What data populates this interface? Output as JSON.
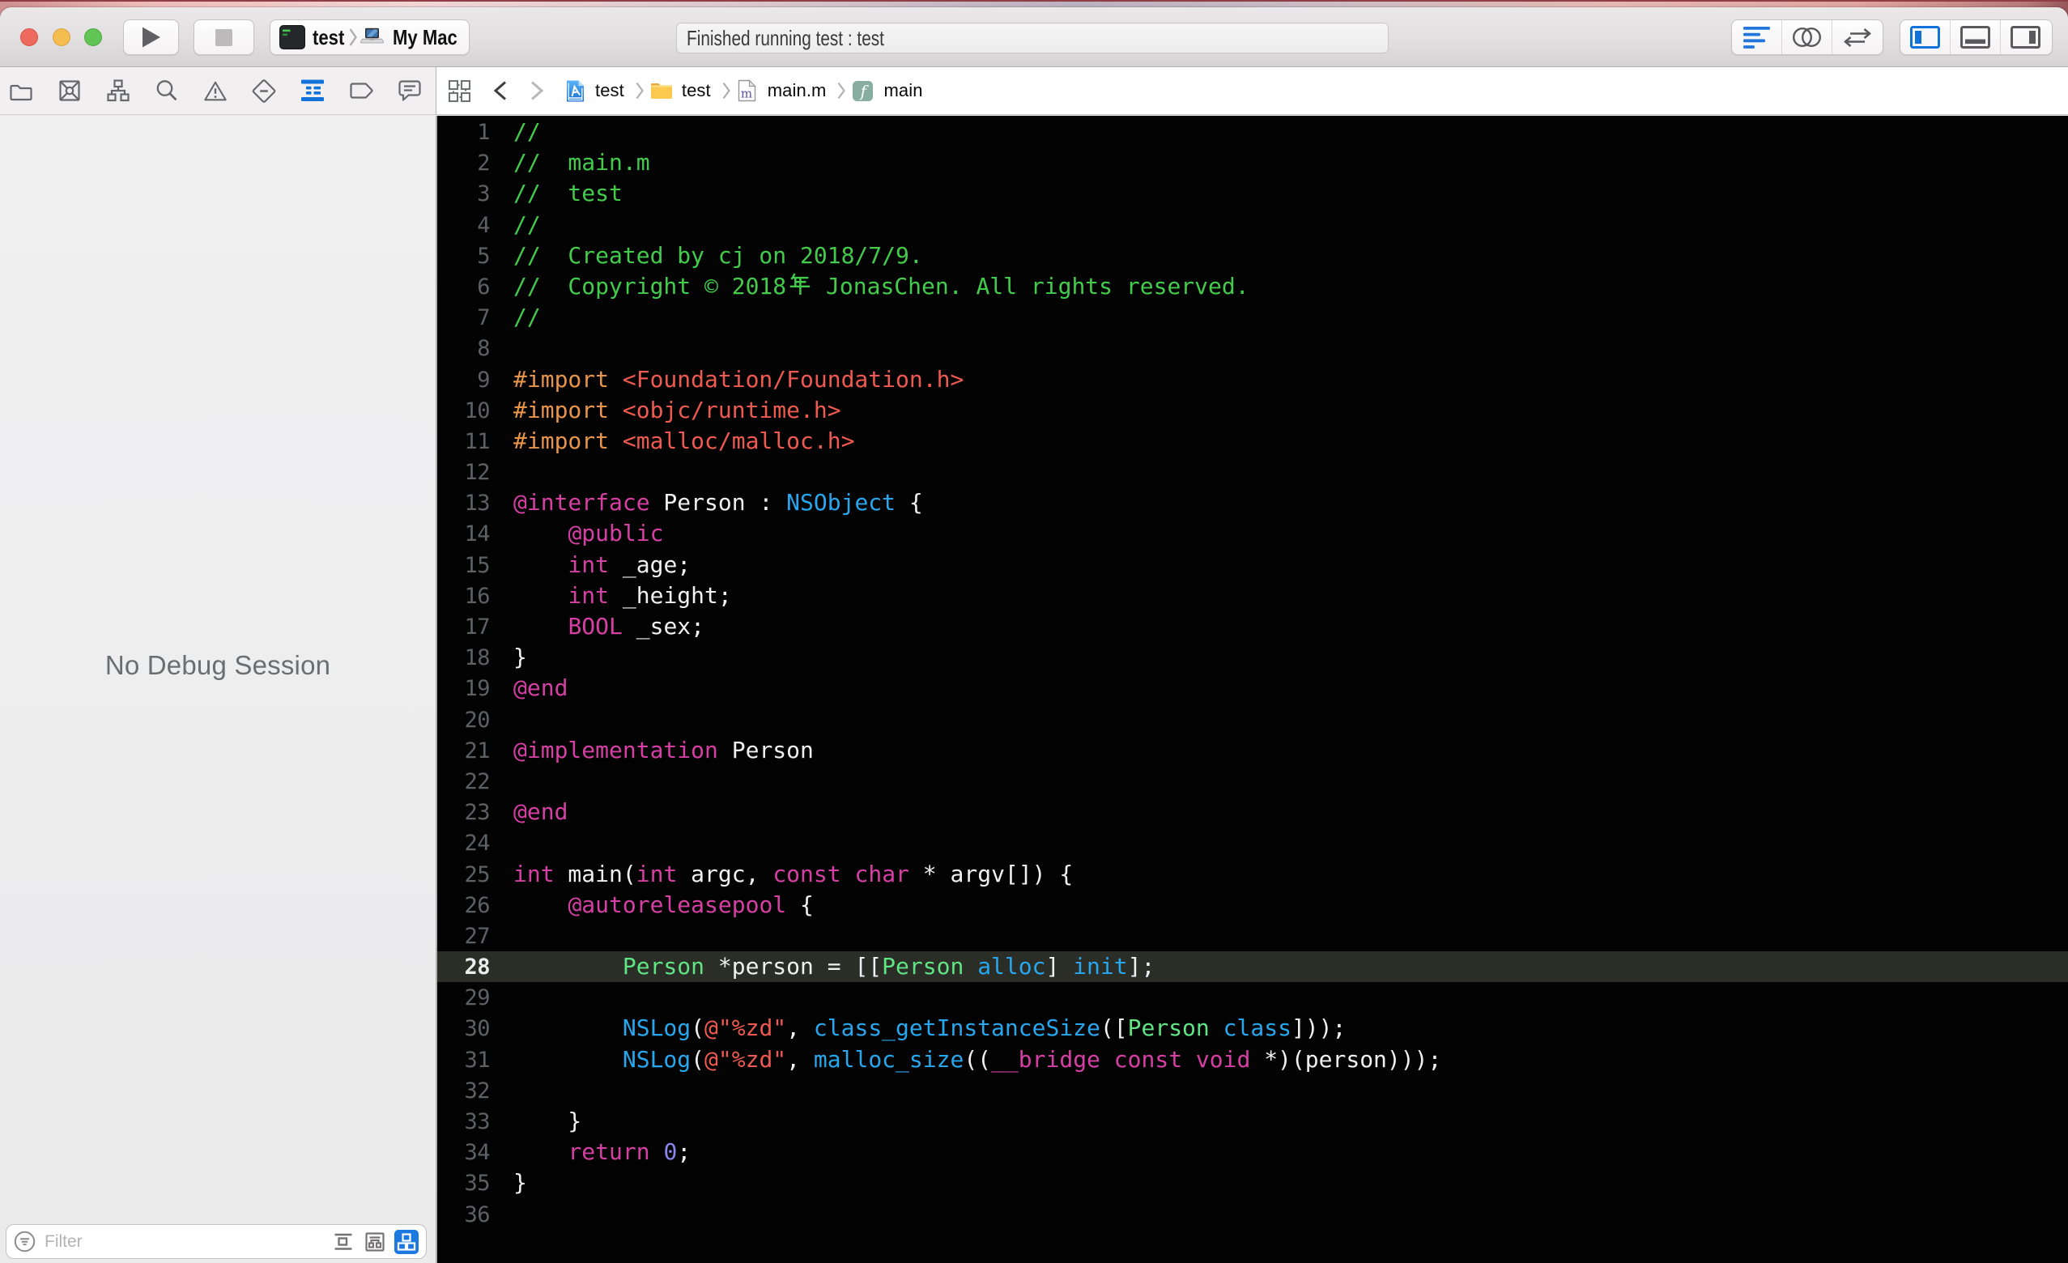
{
  "toolbar": {
    "play_label": "run",
    "stop_label": "stop",
    "scheme": {
      "target": "test",
      "destination": "My Mac"
    },
    "status_text": "Finished running test : test",
    "editor_modes": [
      "standard-editor",
      "assistant-editor",
      "version-editor"
    ],
    "panel_toggles": [
      "navigator-panel",
      "debug-area",
      "inspector-panel"
    ]
  },
  "navigator_bar": {
    "items": [
      "project",
      "source-control",
      "symbol",
      "find",
      "issue",
      "test",
      "debug",
      "breakpoint",
      "report"
    ],
    "active": "debug",
    "accent_color": "#1173d9"
  },
  "jump_bar": {
    "crumbs": [
      {
        "icon": "project-icon",
        "label": "test"
      },
      {
        "icon": "folder-icon",
        "label": "test"
      },
      {
        "icon": "m-file-icon",
        "label": "main.m"
      },
      {
        "icon": "function-icon",
        "label": "main"
      }
    ]
  },
  "sidebar": {
    "empty_text": "No Debug Session"
  },
  "filter_bar": {
    "placeholder": "Filter",
    "view_buttons": [
      "flat-list",
      "group-by-thread",
      "group-by-queue"
    ],
    "active_view": "group-by-queue"
  },
  "editor": {
    "current_line": 28,
    "colors": {
      "background": "#030303",
      "comment": "#43cc4c",
      "preprocessor": "#e7944a",
      "string": "#ee5a50",
      "keyword": "#d63fa4",
      "plain": "#f0f0f0",
      "system": "#28a7ee",
      "project_class": "#5fe584",
      "number": "#8c85f2",
      "line_number": "#5d6165",
      "current_line_bg": "#2b2d27"
    },
    "lines": [
      {
        "n": 1,
        "segs": [
          [
            "//",
            "c"
          ]
        ]
      },
      {
        "n": 2,
        "segs": [
          [
            "//  main.m",
            "c"
          ]
        ]
      },
      {
        "n": 3,
        "segs": [
          [
            "//  test",
            "c"
          ]
        ]
      },
      {
        "n": 4,
        "segs": [
          [
            "//",
            "c"
          ]
        ]
      },
      {
        "n": 5,
        "segs": [
          [
            "//  Created by cj on 2018/7/9.",
            "c"
          ]
        ]
      },
      {
        "n": 6,
        "segs": [
          [
            "//  Copyright © 2018年 JonasChen. All rights reserved.",
            "c"
          ]
        ]
      },
      {
        "n": 7,
        "segs": [
          [
            "//",
            "c"
          ]
        ]
      },
      {
        "n": 8,
        "segs": []
      },
      {
        "n": 9,
        "segs": [
          [
            "#import ",
            "p"
          ],
          [
            "<Foundation/Foundation.h>",
            "s"
          ]
        ]
      },
      {
        "n": 10,
        "segs": [
          [
            "#import ",
            "p"
          ],
          [
            "<objc/runtime.h>",
            "s"
          ]
        ]
      },
      {
        "n": 11,
        "segs": [
          [
            "#import ",
            "p"
          ],
          [
            "<malloc/malloc.h>",
            "s"
          ]
        ]
      },
      {
        "n": 12,
        "segs": []
      },
      {
        "n": 13,
        "segs": [
          [
            "@interface",
            "k"
          ],
          [
            " Person : ",
            "w"
          ],
          [
            "NSObject",
            "y"
          ],
          [
            " {",
            "w"
          ]
        ]
      },
      {
        "n": 14,
        "segs": [
          [
            "    ",
            "w"
          ],
          [
            "@public",
            "k"
          ]
        ]
      },
      {
        "n": 15,
        "segs": [
          [
            "    ",
            "w"
          ],
          [
            "int",
            "k"
          ],
          [
            " _age;",
            "w"
          ]
        ]
      },
      {
        "n": 16,
        "segs": [
          [
            "    ",
            "w"
          ],
          [
            "int",
            "k"
          ],
          [
            " _height;",
            "w"
          ]
        ]
      },
      {
        "n": 17,
        "segs": [
          [
            "    ",
            "w"
          ],
          [
            "BOOL",
            "k"
          ],
          [
            " _sex;",
            "w"
          ]
        ]
      },
      {
        "n": 18,
        "segs": [
          [
            "}",
            "w"
          ]
        ]
      },
      {
        "n": 19,
        "segs": [
          [
            "@end",
            "k"
          ]
        ]
      },
      {
        "n": 20,
        "segs": []
      },
      {
        "n": 21,
        "segs": [
          [
            "@implementation",
            "k"
          ],
          [
            " Person",
            "w"
          ]
        ]
      },
      {
        "n": 22,
        "segs": []
      },
      {
        "n": 23,
        "segs": [
          [
            "@end",
            "k"
          ]
        ]
      },
      {
        "n": 24,
        "segs": []
      },
      {
        "n": 25,
        "segs": [
          [
            "int",
            "k"
          ],
          [
            " main(",
            "w"
          ],
          [
            "int",
            "k"
          ],
          [
            " argc, ",
            "w"
          ],
          [
            "const",
            "k"
          ],
          [
            " ",
            "w"
          ],
          [
            "char",
            "k"
          ],
          [
            " * argv[]) {",
            "w"
          ]
        ]
      },
      {
        "n": 26,
        "segs": [
          [
            "    ",
            "w"
          ],
          [
            "@autoreleasepool",
            "k"
          ],
          [
            " {",
            "w"
          ]
        ]
      },
      {
        "n": 27,
        "segs": []
      },
      {
        "n": 28,
        "segs": [
          [
            "        ",
            "w"
          ],
          [
            "Person",
            "g"
          ],
          [
            " *person = [[",
            "w"
          ],
          [
            "Person",
            "g"
          ],
          [
            " ",
            "w"
          ],
          [
            "alloc",
            "y"
          ],
          [
            "] ",
            "w"
          ],
          [
            "init",
            "y"
          ],
          [
            "];",
            "w"
          ]
        ]
      },
      {
        "n": 29,
        "segs": []
      },
      {
        "n": 30,
        "segs": [
          [
            "        ",
            "w"
          ],
          [
            "NSLog",
            "y"
          ],
          [
            "(",
            "w"
          ],
          [
            "@\"%zd\"",
            "s"
          ],
          [
            ", ",
            "w"
          ],
          [
            "class_getInstanceSize",
            "y"
          ],
          [
            "([",
            "w"
          ],
          [
            "Person",
            "g"
          ],
          [
            " ",
            "w"
          ],
          [
            "class",
            "y"
          ],
          [
            "]));",
            "w"
          ]
        ]
      },
      {
        "n": 31,
        "segs": [
          [
            "        ",
            "w"
          ],
          [
            "NSLog",
            "y"
          ],
          [
            "(",
            "w"
          ],
          [
            "@\"%zd\"",
            "s"
          ],
          [
            ", ",
            "w"
          ],
          [
            "malloc_size",
            "y"
          ],
          [
            "((",
            "w"
          ],
          [
            "__bridge const void",
            "k"
          ],
          [
            " *)(person)));",
            "w"
          ]
        ]
      },
      {
        "n": 32,
        "segs": []
      },
      {
        "n": 33,
        "segs": [
          [
            "    }",
            "w"
          ]
        ]
      },
      {
        "n": 34,
        "segs": [
          [
            "    ",
            "w"
          ],
          [
            "return",
            "k"
          ],
          [
            " ",
            "w"
          ],
          [
            "0",
            "n"
          ],
          [
            ";",
            "w"
          ]
        ]
      },
      {
        "n": 35,
        "segs": [
          [
            "}",
            "w"
          ]
        ]
      },
      {
        "n": 36,
        "segs": []
      }
    ]
  }
}
